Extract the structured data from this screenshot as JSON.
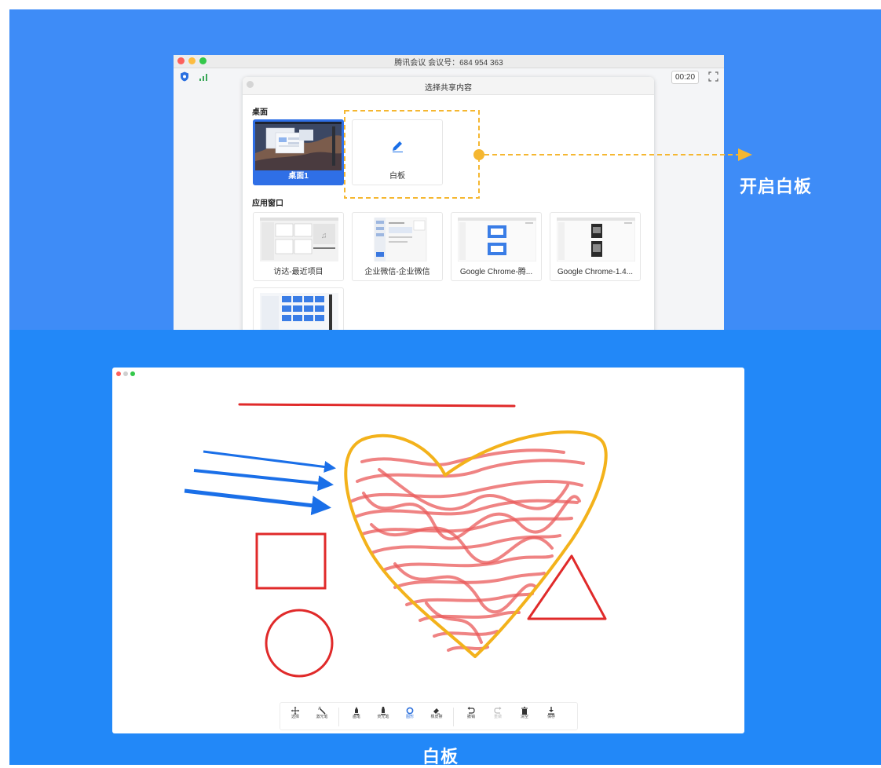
{
  "meeting_window": {
    "title": "腾讯会议 会议号：684 954 363",
    "timer": "00:20"
  },
  "share_dialog": {
    "title": "选择共享内容",
    "desktop_section": "桌面",
    "desktop_cards": [
      {
        "label": "桌面1",
        "selected": true
      },
      {
        "label": "白板",
        "selected": false
      }
    ],
    "apps_section": "应用窗口",
    "app_cards": [
      {
        "label": "访达-最近项目"
      },
      {
        "label": "企业微信-企业微信"
      },
      {
        "label": "Google Chrome-腾..."
      },
      {
        "label": "Google Chrome-1.4..."
      }
    ]
  },
  "annotation": {
    "label": "开启白板",
    "color": "#f5b731"
  },
  "whiteboard": {
    "toolbar": {
      "select": "选择",
      "laser": "激光笔",
      "pen": "画笔",
      "highlighter": "荧光笔",
      "shape": "图形",
      "eraser": "橡皮擦",
      "undo": "撤销",
      "redo": "重做",
      "clear": "清空",
      "save": "保存"
    },
    "active_tool": "shape",
    "colors": {
      "red": "#e02a2a",
      "blue": "#1a6fe8",
      "yellow": "#f3b21b",
      "accent": "#2b6fdc"
    }
  },
  "caption": "白板"
}
